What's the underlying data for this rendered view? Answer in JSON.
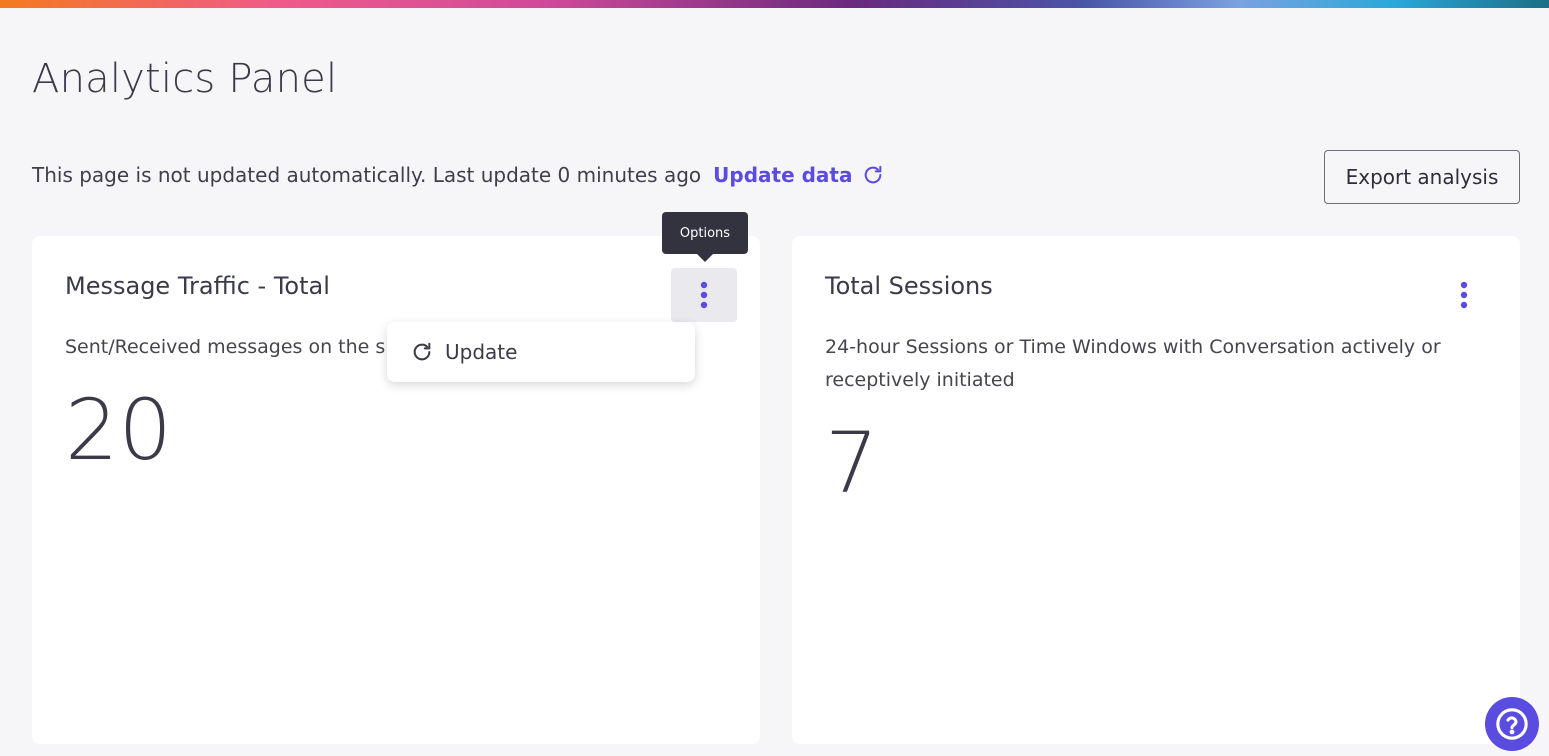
{
  "page": {
    "title": "Analytics Panel",
    "status_text": "This page is not updated automatically. Last update 0 minutes ago",
    "update_link_label": "Update data",
    "export_label": "Export analysis"
  },
  "cards": [
    {
      "title": "Message Traffic - Total",
      "description": "Sent/Received messages on the s",
      "value": "20",
      "options_icon": "kebab-vertical-icon"
    },
    {
      "title": "Total Sessions",
      "description": "24-hour Sessions or Time Windows with Conversation actively or receptively initiated",
      "value": "7",
      "options_icon": "kebab-vertical-icon"
    }
  ],
  "tooltip": {
    "label": "Options"
  },
  "dropdown": {
    "items": [
      {
        "label": "Update",
        "icon": "refresh-icon"
      }
    ]
  },
  "help": {
    "icon": "question-circle-icon"
  },
  "colors": {
    "accent": "#5b4ce0",
    "background": "#f6f6f8",
    "card": "#ffffff",
    "tooltip_bg": "#33333f"
  }
}
